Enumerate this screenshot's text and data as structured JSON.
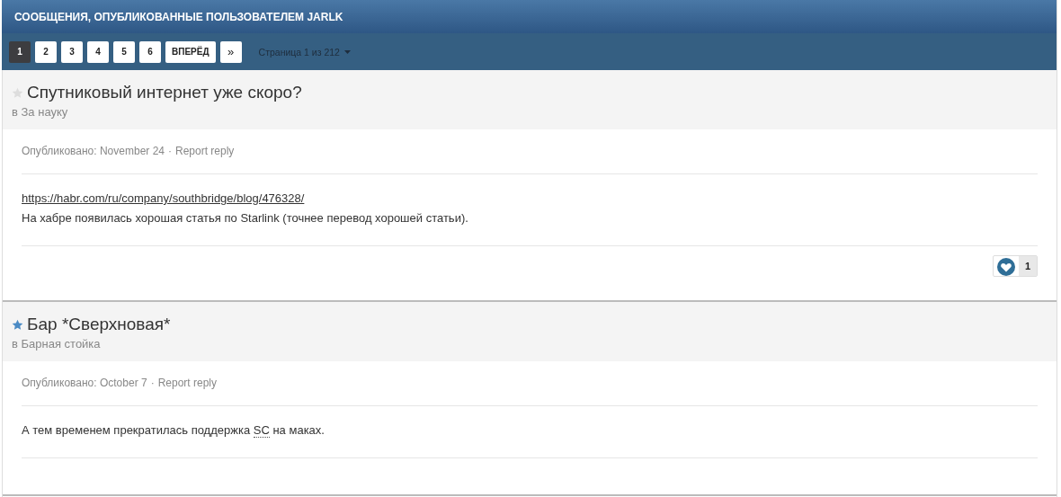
{
  "header": {
    "title": "СООБЩЕНИЯ, ОПУБЛИКОВАННЫЕ ПОЛЬЗОВАТЕЛЕМ JARLK"
  },
  "pagination": {
    "pages": [
      {
        "label": "1",
        "selected": true
      },
      {
        "label": "2",
        "selected": false
      },
      {
        "label": "3",
        "selected": false
      },
      {
        "label": "4",
        "selected": false
      },
      {
        "label": "5",
        "selected": false
      },
      {
        "label": "6",
        "selected": false
      }
    ],
    "next": "ВПЕРЁД",
    "last": "»",
    "page_info": "Страница 1 из 212"
  },
  "posts": [
    {
      "title": "Спутниковый интернет уже скоро?",
      "followed": false,
      "forum": "в За науку",
      "posted": "Опубликовано: November 24",
      "separator": "·",
      "report": "Report reply",
      "content": [
        {
          "kind": "link",
          "segments": [
            {
              "kind": "text",
              "text": "https://habr.com/ru/company/southbridge/blog/476328/"
            }
          ]
        },
        {
          "kind": "paragraph",
          "segments": [
            {
              "kind": "text",
              "text": "На хабре появилась хорошая статья по Starlink (точнее перевод хорошей статьи)."
            }
          ]
        }
      ],
      "likes": "1"
    },
    {
      "title": "Бар *Сверхновая*",
      "followed": true,
      "forum": "в Барная стойка",
      "posted": "Опубликовано: October 7",
      "separator": "·",
      "report": "Report reply",
      "content": [
        {
          "kind": "paragraph",
          "segments": [
            {
              "kind": "text",
              "text": "А тем временем прекратилась поддержка "
            },
            {
              "kind": "abbr",
              "text": "SC"
            },
            {
              "kind": "text",
              "text": " на маках."
            }
          ]
        }
      ]
    }
  ]
}
